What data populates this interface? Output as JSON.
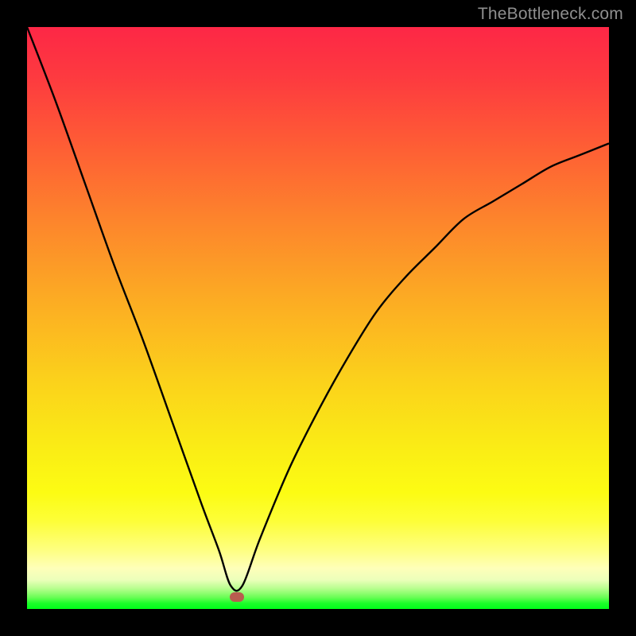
{
  "watermark": "TheBottleneck.com",
  "colors": {
    "page_bg": "#000000",
    "curve": "#000000",
    "marker": "#b85d4f",
    "watermark": "#8f8f8f",
    "gradient_top": "#fd2746",
    "gradient_bottom": "#00ff19"
  },
  "chart_data": {
    "type": "line",
    "title": "",
    "xlabel": "",
    "ylabel": "",
    "xlim": [
      0,
      100
    ],
    "ylim": [
      0,
      100
    ],
    "grid": false,
    "legend": false,
    "marker": {
      "x": 36,
      "y": 2
    },
    "series": [
      {
        "name": "bottleneck-curve",
        "x": [
          0,
          5,
          10,
          15,
          20,
          25,
          30,
          33,
          35,
          37,
          40,
          45,
          50,
          55,
          60,
          65,
          70,
          75,
          80,
          85,
          90,
          95,
          100
        ],
        "y": [
          100,
          87,
          73,
          59,
          46,
          32,
          18,
          10,
          4,
          4,
          12,
          24,
          34,
          43,
          51,
          57,
          62,
          67,
          70,
          73,
          76,
          78,
          80
        ]
      }
    ]
  }
}
